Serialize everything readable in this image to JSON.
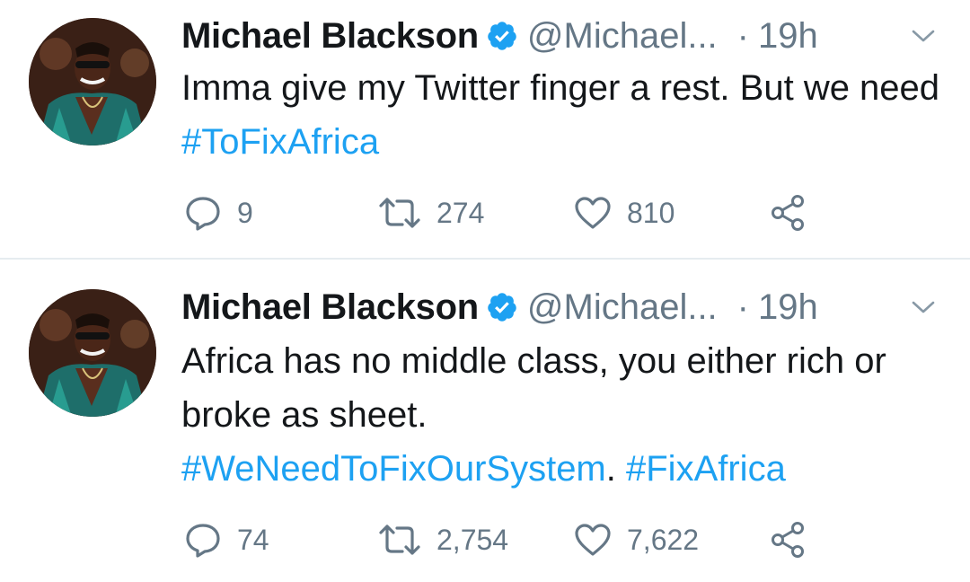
{
  "tweets": [
    {
      "author_name": "Michael Blackson",
      "handle": "@Michael...",
      "separator": "·",
      "time": "19h",
      "text_segments": [
        {
          "text": "Imma give my Twitter finger a rest. But we need ",
          "type": "text"
        },
        {
          "text": "#ToFixAfrica",
          "type": "hashtag"
        }
      ],
      "replies": "9",
      "retweets": "274",
      "likes": "810"
    },
    {
      "author_name": "Michael Blackson",
      "handle": "@Michael...",
      "separator": "·",
      "time": "19h",
      "text_segments": [
        {
          "text": "Africa has no middle class, you either rich or broke as sheet.",
          "type": "text"
        },
        {
          "text": "#WeNeedToFixOurSystem",
          "type": "hashtag"
        },
        {
          "text": ". ",
          "type": "text"
        },
        {
          "text": "#FixAfrica",
          "type": "hashtag"
        }
      ],
      "replies": "74",
      "retweets": "2,754",
      "likes": "7,622"
    }
  ],
  "icons": {
    "verified": "verified-badge-icon",
    "caret": "chevron-down-icon",
    "reply": "reply-icon",
    "retweet": "retweet-icon",
    "like": "heart-icon",
    "share": "share-icon"
  },
  "colors": {
    "text": "#14171a",
    "muted": "#657786",
    "link": "#1da1f2",
    "verified": "#1da1f2",
    "divider": "#e6ecf0"
  }
}
